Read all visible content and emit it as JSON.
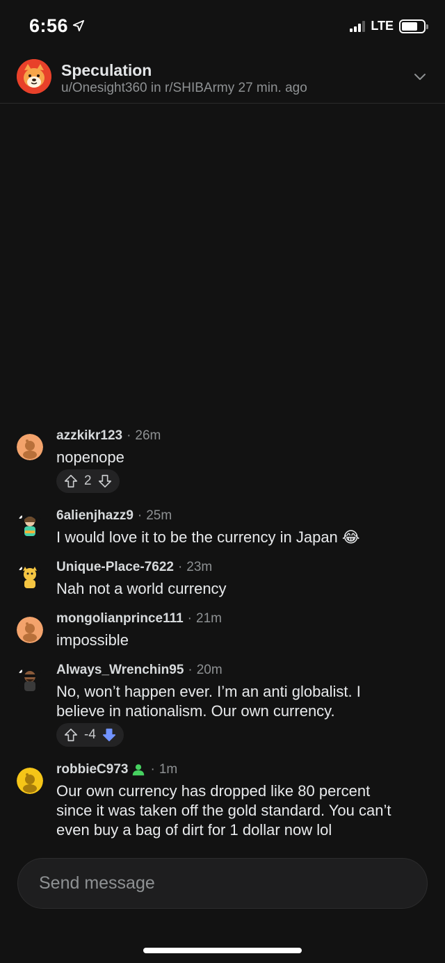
{
  "status_bar": {
    "time": "6:56",
    "network": "LTE"
  },
  "header": {
    "title": "Speculation",
    "subtitle": "u/Onesight360 in r/SHIBArmy 27 min. ago"
  },
  "messages": [
    {
      "user": "azzkikr123",
      "time": "26m",
      "text": "nopenope",
      "votes": "2",
      "vote_state": "none"
    },
    {
      "user": "6alienjhazz9",
      "time": "25m",
      "text": "I would love it to be the currency in Japan 😂"
    },
    {
      "user": "Unique-Place-7622",
      "time": "23m",
      "text": "Nah not a world currency"
    },
    {
      "user": "mongolianprince111",
      "time": "21m",
      "text": "impossible"
    },
    {
      "user": "Always_Wrenchin95",
      "time": "20m",
      "text": "No, won’t happen ever. I’m an anti globalist. I believe in nationalism. Our own currency.",
      "votes": "-4",
      "vote_state": "downvoted"
    },
    {
      "user": "robbieC973",
      "time": "1m",
      "text": "Our own currency has dropped like 80 percent since it was taken off the gold standard. You can’t even buy a bag of dirt for 1 dollar now lol",
      "online": true
    }
  ],
  "composer": {
    "placeholder": "Send message"
  },
  "colors": {
    "background": "#121212",
    "downvote": "#7193ff",
    "online": "#46d160",
    "community_avatar": "#e8412a"
  }
}
